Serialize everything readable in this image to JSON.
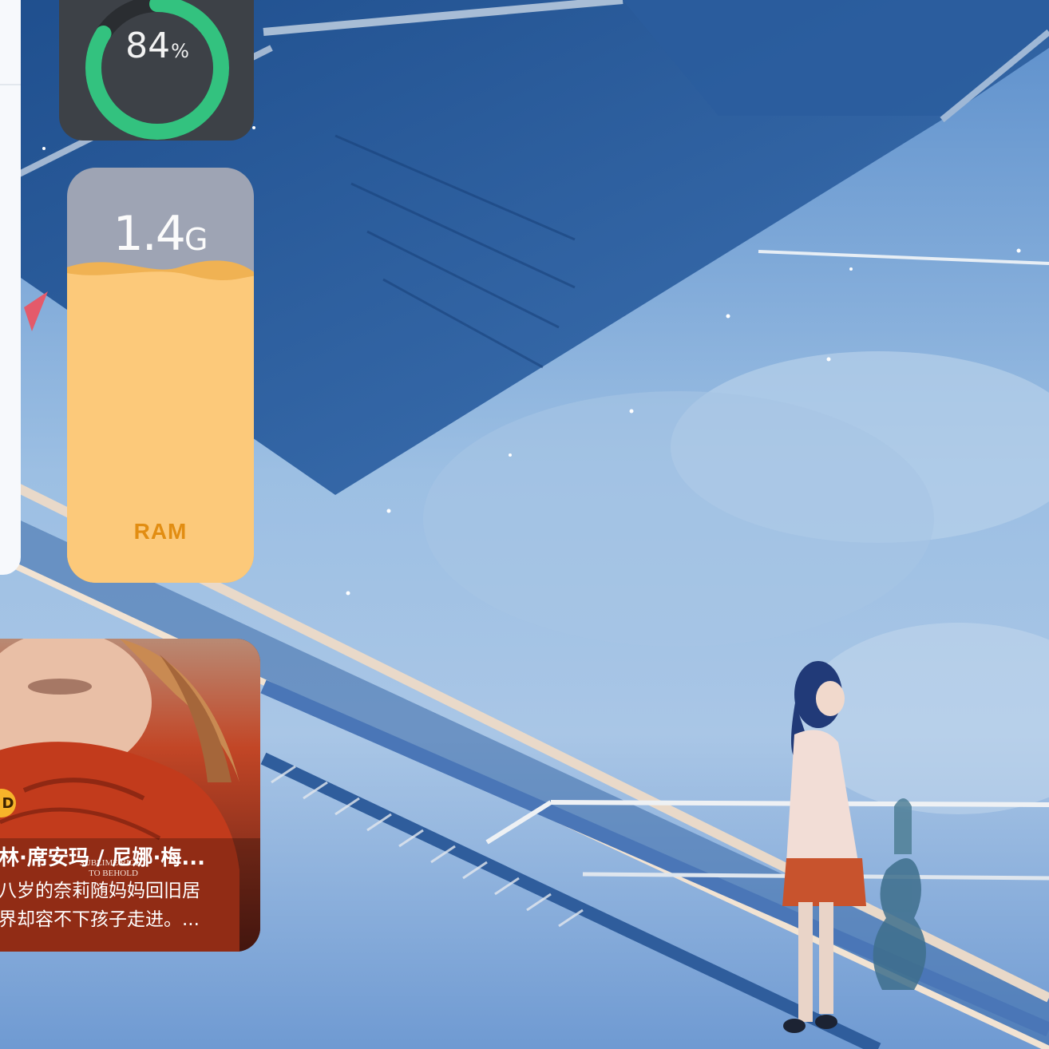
{
  "battery": {
    "value": "84",
    "unit": "%",
    "level": 0.84,
    "color": "#33c27f",
    "track_color": "#2a2d31"
  },
  "ram": {
    "value": "1.4",
    "unit": "G",
    "label": "RAM",
    "level": 0.76,
    "fill_color": "#fcc97a",
    "wave_color": "#f8b448"
  },
  "movie_card": {
    "badge": "D",
    "title": "林·席安玛 / 尼娜·梅...",
    "description_lines": [
      "八岁的奈莉随妈妈回旧居",
      "界却容不下孩子走进。..."
    ],
    "poster_text_1": "SUBLIME RIGHT",
    "poster_text_2": "TO BEHOLD"
  }
}
